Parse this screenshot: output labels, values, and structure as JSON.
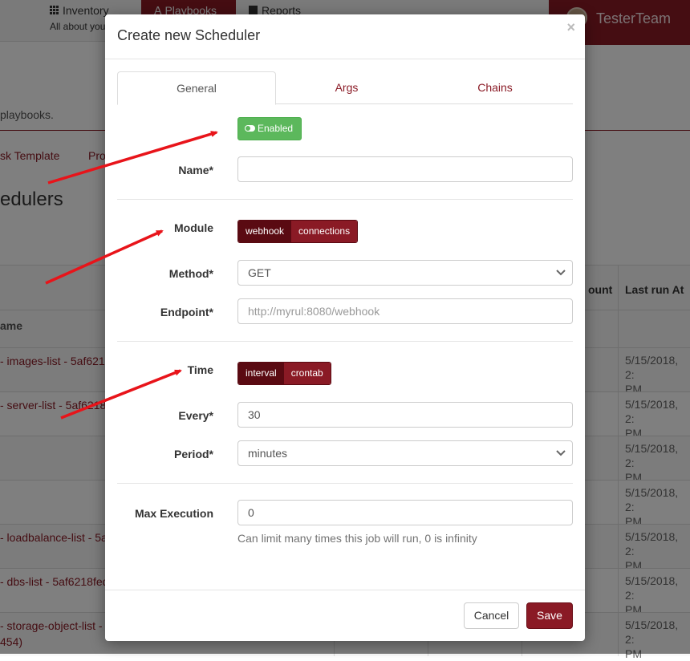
{
  "nav": {
    "inventory": "Inventory",
    "inventory_sub": "All about you",
    "playbooks": "Playbooks",
    "reports": "Reports",
    "user": "TesterTeam"
  },
  "background": {
    "description_tail": "playbooks.",
    "link_task_template": "sk Template",
    "link_pro": "Pro",
    "heading_tail": "edulers",
    "col_count_tail": "ount",
    "col_last_run": "Last run At",
    "subheader_tail": "ame",
    "rows": [
      {
        "name": "- images-list - 5af6218",
        "date": "5/15/2018, 2:\nPM"
      },
      {
        "name": "- server-list - 5af6218",
        "date": "5/15/2018, 2:\nPM"
      },
      {
        "name": "",
        "date": "5/15/2018, 2:\nPM"
      },
      {
        "name": "",
        "date": "5/15/2018, 2:\nPM"
      },
      {
        "name": "- loadbalance-list - 5a",
        "date": "5/15/2018, 2:\nPM"
      },
      {
        "name": "- dbs-list - 5af6218fed",
        "date": "5/15/2018, 2:\nPM"
      },
      {
        "name": "- storage-object-list - 5",
        "name2": "454)",
        "date": "5/15/2018, 2:\nPM"
      }
    ]
  },
  "modal": {
    "title": "Create new Scheduler",
    "close": "×",
    "tabs": [
      {
        "label": "General",
        "active": true
      },
      {
        "label": "Args",
        "active": false
      },
      {
        "label": "Chains",
        "active": false
      }
    ],
    "enabled_button": "Enabled",
    "name_label": "Name*",
    "name_value": "",
    "module_label": "Module",
    "module_options": [
      "webhook",
      "connections"
    ],
    "module_selected": "webhook",
    "method_label": "Method*",
    "method_value": "GET",
    "endpoint_label": "Endpoint*",
    "endpoint_placeholder": "http://myrul:8080/webhook",
    "time_label": "Time",
    "time_options": [
      "interval",
      "crontab"
    ],
    "time_selected": "interval",
    "every_label": "Every*",
    "every_value": "30",
    "period_label": "Period*",
    "period_value": "minutes",
    "max_exec_label": "Max Execution",
    "max_exec_value": "0",
    "max_exec_help": "Can limit many times this job will run, 0 is infinity",
    "cancel": "Cancel",
    "save": "Save"
  },
  "colors": {
    "brand": "#8a1a25",
    "brand_dark": "#5a0a12",
    "success": "#5cb85c",
    "arrow": "#e8141a"
  }
}
